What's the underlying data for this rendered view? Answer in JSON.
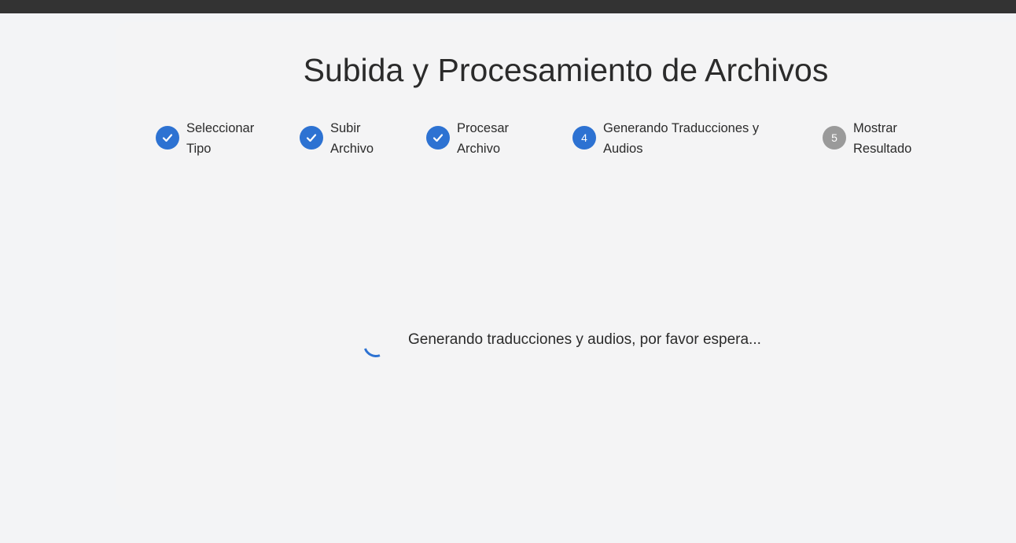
{
  "page": {
    "title": "Subida y Procesamiento de Archivos"
  },
  "steps": [
    {
      "number": "1",
      "label_line1": "Seleccionar",
      "label_line2": "Tipo",
      "status": "completed",
      "icon": "check-icon"
    },
    {
      "number": "2",
      "label_line1": "Subir",
      "label_line2": "Archivo",
      "status": "completed",
      "icon": "check-icon"
    },
    {
      "number": "3",
      "label_line1": "Procesar",
      "label_line2": "Archivo",
      "status": "completed",
      "icon": "check-icon"
    },
    {
      "number": "4",
      "label_line1": "Generando Traducciones y",
      "label_line2": "Audios",
      "status": "active"
    },
    {
      "number": "5",
      "label_line1": "Mostrar",
      "label_line2": "Resultado",
      "status": "pending"
    }
  ],
  "loading": {
    "message": "Generando traducciones y audios, por favor espera...",
    "icon": "spinner-icon"
  },
  "colors": {
    "accent": "#2d72d2",
    "pending": "#9a9a9a",
    "topbar": "#333333",
    "background": "#f3f4f6"
  }
}
